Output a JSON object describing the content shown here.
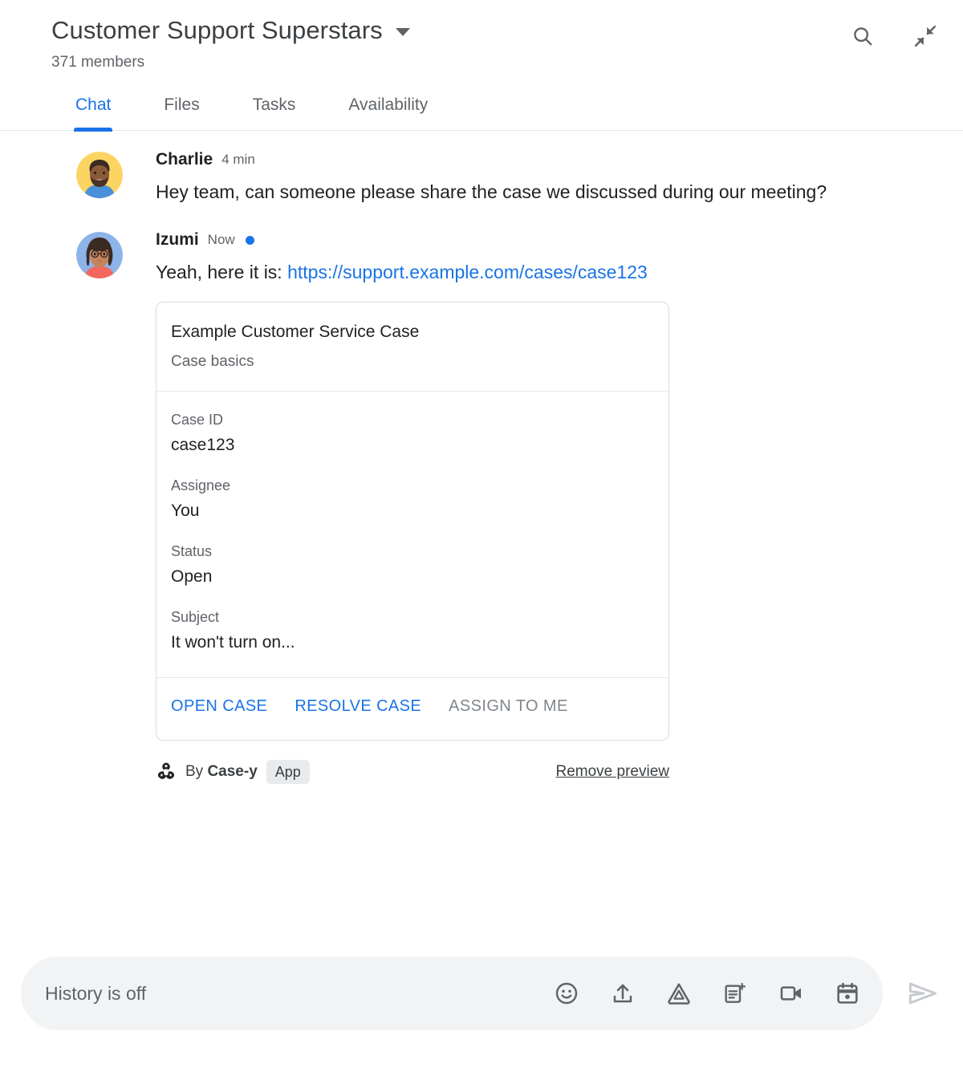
{
  "header": {
    "room_title": "Customer Support Superstars",
    "member_count": "371 members",
    "dropdown_icon": "chevron-down-icon",
    "actions": [
      {
        "name": "search-icon",
        "label": "Search"
      },
      {
        "name": "collapse-icon",
        "label": "Collapse"
      }
    ]
  },
  "tabs": [
    {
      "label": "Chat",
      "active": true
    },
    {
      "label": "Files",
      "active": false
    },
    {
      "label": "Tasks",
      "active": false
    },
    {
      "label": "Availability",
      "active": false
    }
  ],
  "messages": [
    {
      "sender": "Charlie",
      "timestamp": "4 min",
      "unread": false,
      "text": "Hey team, can someone please share the case we discussed during our meeting?"
    },
    {
      "sender": "Izumi",
      "timestamp": "Now",
      "unread": true,
      "text_prefix": "Yeah, here it is: ",
      "link_text": "https://support.example.com/cases/case123"
    }
  ],
  "card": {
    "title": "Example Customer Service Case",
    "subtitle": "Case basics",
    "fields": [
      {
        "label": "Case ID",
        "value": "case123"
      },
      {
        "label": "Assignee",
        "value": "You"
      },
      {
        "label": "Status",
        "value": "Open"
      },
      {
        "label": "Subject",
        "value": "It won't turn on..."
      }
    ],
    "actions": [
      {
        "label": "OPEN CASE",
        "enabled": true
      },
      {
        "label": "RESOLVE CASE",
        "enabled": true
      },
      {
        "label": "ASSIGN TO ME",
        "enabled": false
      }
    ]
  },
  "attribution": {
    "bot_icon": "webhook-bot-icon",
    "by_prefix": "By ",
    "app_name": "Case-y",
    "chip_label": "App",
    "remove_label": "Remove preview"
  },
  "composer": {
    "placeholder": "History is off",
    "value": "",
    "icons": [
      "emoji-icon",
      "upload-icon",
      "google-drive-icon",
      "create-doc-icon",
      "video-camera-icon",
      "calendar-icon"
    ],
    "send_label": "Send"
  },
  "colors": {
    "accent": "#1a73e8",
    "text_primary": "#202124",
    "text_secondary": "#5f6368",
    "border": "#dadce0",
    "composer_bg": "#f1f3f4",
    "chip_bg": "#e8eaed",
    "disabled": "#80868b"
  }
}
